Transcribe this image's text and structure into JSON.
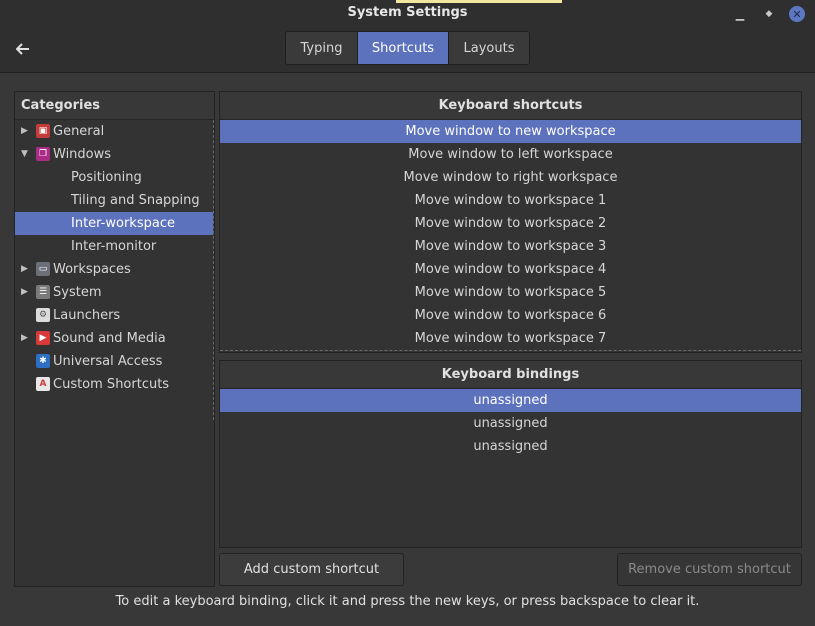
{
  "window": {
    "title": "System Settings"
  },
  "header": {
    "tabs": [
      {
        "label": "Typing",
        "active": false
      },
      {
        "label": "Shortcuts",
        "active": true
      },
      {
        "label": "Layouts",
        "active": false
      }
    ]
  },
  "categories": {
    "header": "Categories",
    "items": [
      {
        "label": "General",
        "icon": "general-icon",
        "color": "#c43b3b",
        "expanded": false,
        "level": 0
      },
      {
        "label": "Windows",
        "icon": "windows-icon",
        "color": "#a92d86",
        "expanded": true,
        "level": 0
      },
      {
        "label": "Positioning",
        "level": 1
      },
      {
        "label": "Tiling and Snapping",
        "level": 1
      },
      {
        "label": "Inter-workspace",
        "level": 1,
        "selected": true
      },
      {
        "label": "Inter-monitor",
        "level": 1
      },
      {
        "label": "Workspaces",
        "icon": "monitor-icon",
        "color": "#6b6f78",
        "expanded": false,
        "level": 0
      },
      {
        "label": "System",
        "icon": "system-icon",
        "color": "#7a7a7a",
        "expanded": false,
        "level": 0
      },
      {
        "label": "Launchers",
        "icon": "launchers-icon",
        "color": "#dcdcdc",
        "level": 0
      },
      {
        "label": "Sound and Media",
        "icon": "media-icon",
        "color": "#d83a3a",
        "expanded": false,
        "level": 0
      },
      {
        "label": "Universal Access",
        "icon": "accessibility-icon",
        "color": "#2d6fc3",
        "level": 0
      },
      {
        "label": "Custom Shortcuts",
        "icon": "custom-shortcuts-icon",
        "color": "#c7403e",
        "level": 0
      }
    ]
  },
  "shortcuts": {
    "header": "Keyboard shortcuts",
    "items": [
      "Move window to new workspace",
      "Move window to left workspace",
      "Move window to right workspace",
      "Move window to workspace 1",
      "Move window to workspace 2",
      "Move window to workspace 3",
      "Move window to workspace 4",
      "Move window to workspace 5",
      "Move window to workspace 6",
      "Move window to workspace 7"
    ],
    "selected_index": 0
  },
  "bindings": {
    "header": "Keyboard bindings",
    "items": [
      "unassigned",
      "unassigned",
      "unassigned"
    ],
    "selected_index": 0
  },
  "buttons": {
    "add": "Add custom shortcut",
    "remove": "Remove custom shortcut"
  },
  "hint": "To edit a keyboard binding, click it and press the new keys, or press backspace to clear it.",
  "colors": {
    "accent": "#5d72bd",
    "background": "#383838"
  }
}
